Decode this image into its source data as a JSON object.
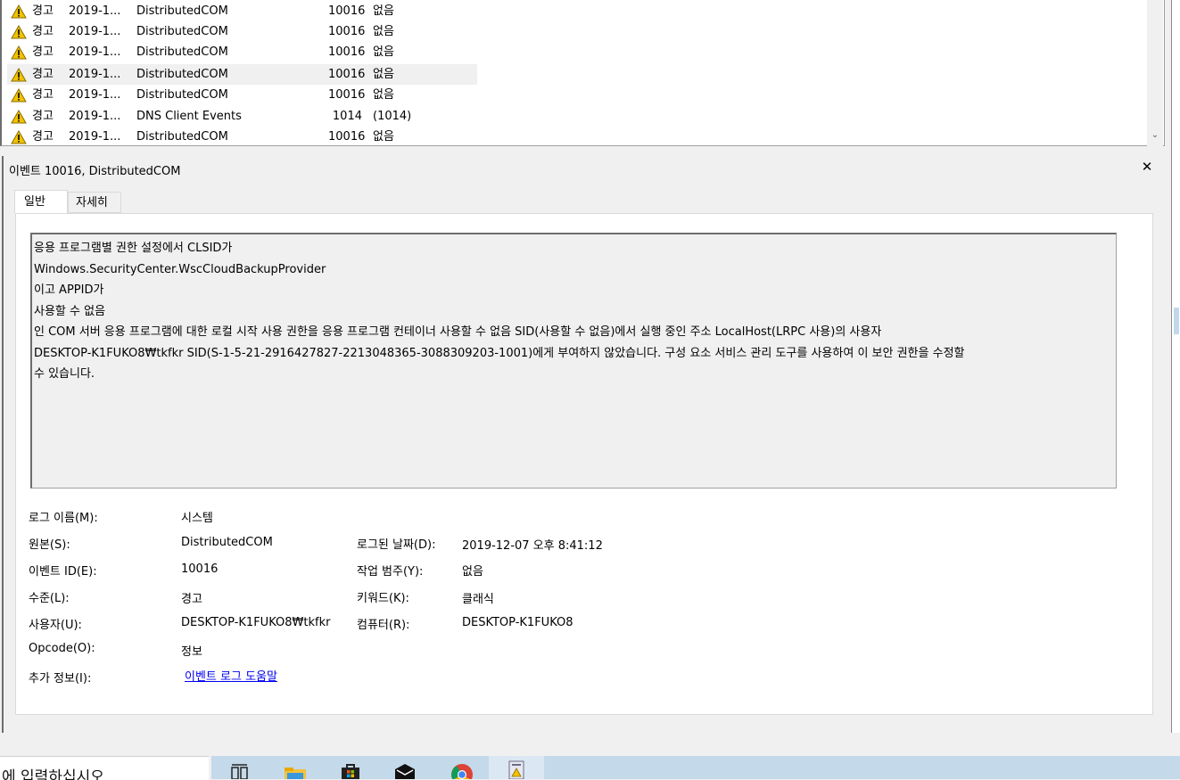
{
  "event_rows": [
    {
      "level": "경고",
      "date": "2019-1...",
      "source": "DistributedCOM",
      "id": "10016",
      "category": "없음",
      "selected": false
    },
    {
      "level": "경고",
      "date": "2019-1...",
      "source": "DistributedCOM",
      "id": "10016",
      "category": "없음",
      "selected": false
    },
    {
      "level": "경고",
      "date": "2019-1...",
      "source": "DistributedCOM",
      "id": "10016",
      "category": "없음",
      "selected": false
    },
    {
      "level": "경고",
      "date": "2019-1...",
      "source": "DistributedCOM",
      "id": "10016",
      "category": "없음",
      "selected": true
    },
    {
      "level": "경고",
      "date": "2019-1...",
      "source": "DistributedCOM",
      "id": "10016",
      "category": "없음",
      "selected": false
    },
    {
      "level": "경고",
      "date": "2019-1...",
      "source": "DNS Client Events",
      "id": "1014",
      "category": "(1014)",
      "selected": false
    },
    {
      "level": "경고",
      "date": "2019-1...",
      "source": "DistributedCOM",
      "id": "10016",
      "category": "없음",
      "selected": false
    }
  ],
  "detail": {
    "title": "이벤트 10016, DistributedCOM",
    "tabs": [
      "일반",
      "자세히"
    ],
    "description_lines": [
      "응용 프로그램별 권한 설정에서 CLSID가",
      "Windows.SecurityCenter.WscCloudBackupProvider",
      "이고 APPID가",
      "사용할 수 없음",
      "인 COM 서버 응용 프로그램에 대한 로컬 시작 사용 권한을 응용 프로그램 컨테이너 사용할 수 없음 SID(사용할 수 없음)에서 실행 중인 주소 LocalHost(LRPC 사용)의 사용자",
      "DESKTOP-K1FUKO8₩tkfkr SID(S-1-5-21-2916427827-2213048365-3088309203-1001)에게 부여하지 않았습니다. 구성 요소 서비스 관리 도구를 사용하여 이 보안 권한을 수정할",
      "수 있습니다."
    ],
    "fields": {
      "log_name_label": "로그 이름(M):",
      "log_name": "시스템",
      "source_label": "원본(S):",
      "source": "DistributedCOM",
      "logged_label": "로그된 날짜(D):",
      "logged": "2019-12-07 오후 8:41:12",
      "event_id_label": "이벤트 ID(E):",
      "event_id": "10016",
      "task_label": "작업 범주(Y):",
      "task": "없음",
      "level_label": "수준(L):",
      "level": "경고",
      "keywords_label": "키워드(K):",
      "keywords": "클래식",
      "user_label": "사용자(U):",
      "user": "DESKTOP-K1FUKO8₩tkfkr",
      "computer_label": "컴퓨터(R):",
      "computer": "DESKTOP-K1FUKO8",
      "opcode_label": "Opcode(O):",
      "opcode": "정보",
      "more_info_label": "추가 정보(I):",
      "more_info_link": "이벤트 로그 도움말"
    }
  },
  "taskbar": {
    "search_text": "에 입력하십시오"
  },
  "icons": {
    "warning": "warning-icon",
    "close": "close-icon",
    "scroll_down": "chevron-down-icon"
  }
}
